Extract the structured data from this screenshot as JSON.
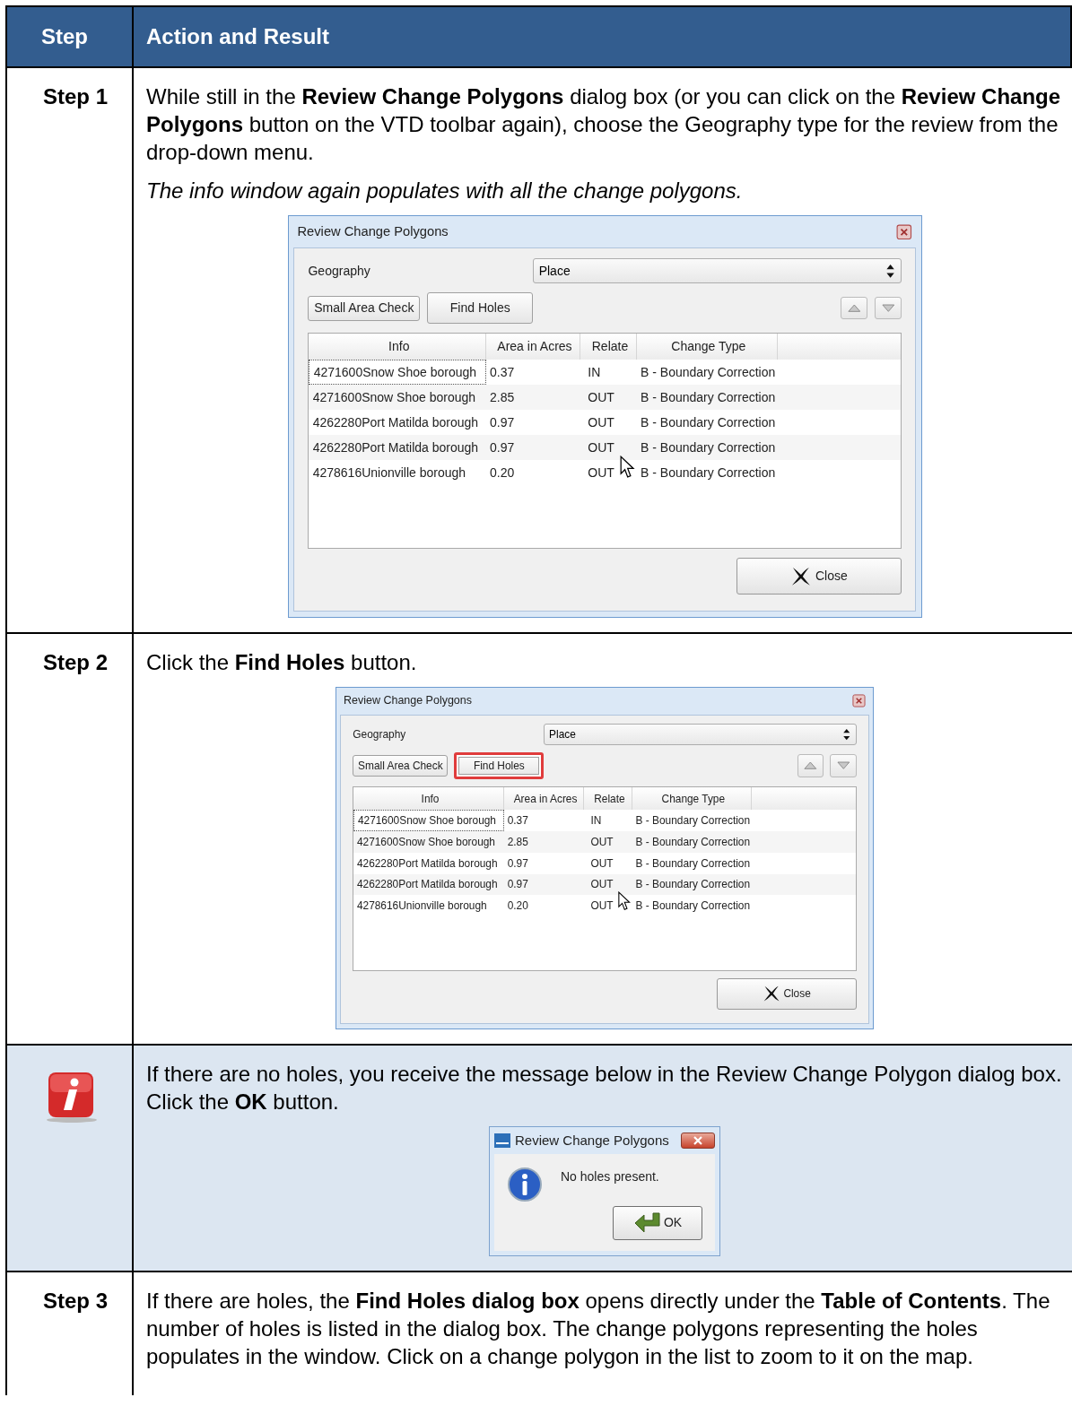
{
  "header": {
    "columns": [
      "Step",
      "Action and Result"
    ]
  },
  "rows": [
    {
      "kind": "step",
      "label": "Step 1",
      "content": [
        {
          "kind": "text",
          "text": "While still in the **Review Change Polygons** dialog box (or you can click on the **Review Change Polygons** button on the VTD toolbar again), choose the Geography type for the review from the drop-down menu."
        },
        {
          "kind": "italic",
          "text": "The info window again populates with all the change polygons."
        },
        {
          "kind": "dialog",
          "title": "Review Change Polygons",
          "geography_label": "Geography",
          "geography_value": "Place",
          "buttons": [
            {
              "label": "Small Area Check",
              "highlighted": false
            },
            {
              "label": "Find Holes",
              "highlighted": false
            }
          ],
          "columns": [
            "Info",
            "Area in Acres",
            "Relate",
            "Change Type"
          ],
          "rows": [
            {
              "cells": [
                "4271600Snow Shoe borough",
                "0.37",
                "IN",
                "B - Boundary Correction"
              ],
              "focused": true
            },
            {
              "cells": [
                "4271600Snow Shoe borough",
                "2.85",
                "OUT",
                "B - Boundary Correction"
              ],
              "focused": false
            },
            {
              "cells": [
                "4262280Port Matilda borough",
                "0.97",
                "OUT",
                "B - Boundary Correction"
              ],
              "focused": false
            },
            {
              "cells": [
                "4262280Port Matilda borough",
                "0.97",
                "OUT",
                "B - Boundary Correction"
              ],
              "focused": false
            },
            {
              "cells": [
                "4278616Unionville borough",
                "0.20",
                "OUT",
                "B - Boundary Correction"
              ],
              "focused": false
            }
          ],
          "close": "Close"
        }
      ]
    },
    {
      "kind": "step",
      "label": "Step 2",
      "content": [
        {
          "kind": "text",
          "text": "Click the **Find Holes** button."
        },
        {
          "kind": "dialog",
          "title": "Review Change Polygons",
          "geography_label": "Geography",
          "geography_value": "Place",
          "buttons": [
            {
              "label": "Small Area Check",
              "highlighted": false
            },
            {
              "label": "Find Holes",
              "highlighted": true
            }
          ],
          "columns": [
            "Info",
            "Area in Acres",
            "Relate",
            "Change Type"
          ],
          "rows": [
            {
              "cells": [
                "4271600Snow Shoe borough",
                "0.37",
                "IN",
                "B - Boundary Correction"
              ],
              "focused": true
            },
            {
              "cells": [
                "4271600Snow Shoe borough",
                "2.85",
                "OUT",
                "B - Boundary Correction"
              ],
              "focused": false
            },
            {
              "cells": [
                "4262280Port Matilda borough",
                "0.97",
                "OUT",
                "B - Boundary Correction"
              ],
              "focused": false
            },
            {
              "cells": [
                "4262280Port Matilda borough",
                "0.97",
                "OUT",
                "B - Boundary Correction"
              ],
              "focused": false
            },
            {
              "cells": [
                "4278616Unionville borough",
                "0.20",
                "OUT",
                "B - Boundary Correction"
              ],
              "focused": false
            }
          ],
          "close": "Close"
        }
      ]
    },
    {
      "kind": "note",
      "content": [
        {
          "kind": "text",
          "text": "If there are no holes, you receive the message below in the Review Change Polygon dialog box. Click the **OK** button."
        },
        {
          "kind": "message",
          "title": "Review Change Polygons",
          "text": "No holes present.",
          "button": "OK"
        }
      ]
    },
    {
      "kind": "step",
      "label": "Step 3",
      "content": [
        {
          "kind": "text",
          "text": "If there are holes, the **Find Holes dialog box** opens directly under the **Table of Contents**. The number of holes is listed in the dialog box. The change polygons representing the holes populates in the window. Click on a change polygon in the list to zoom to it on the map."
        }
      ]
    }
  ]
}
